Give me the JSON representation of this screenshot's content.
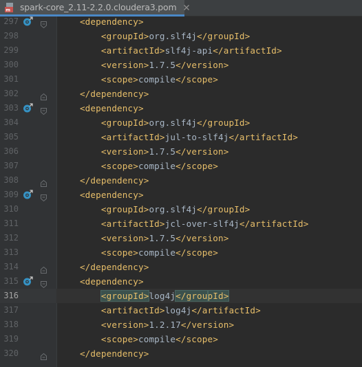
{
  "tab": {
    "title": "spark-core_2.11-2.2.0.cloudera3.pom",
    "file_icon": "maven-pom-file-icon",
    "close_icon": "close-icon"
  },
  "editor": {
    "indent_unit": "    ",
    "lines": [
      {
        "num": "297",
        "marker": true,
        "fold": "open",
        "indent": 1,
        "segments": [
          {
            "t": "tag",
            "v": "<dependency>"
          }
        ]
      },
      {
        "num": "298",
        "marker": false,
        "fold": "",
        "indent": 2,
        "segments": [
          {
            "t": "tag",
            "v": "<groupId>"
          },
          {
            "t": "txt",
            "v": "org.slf4j"
          },
          {
            "t": "tag",
            "v": "</groupId>"
          }
        ]
      },
      {
        "num": "299",
        "marker": false,
        "fold": "",
        "indent": 2,
        "segments": [
          {
            "t": "tag",
            "v": "<artifactId>"
          },
          {
            "t": "txt",
            "v": "slf4j-api"
          },
          {
            "t": "tag",
            "v": "</artifactId>"
          }
        ]
      },
      {
        "num": "300",
        "marker": false,
        "fold": "",
        "indent": 2,
        "segments": [
          {
            "t": "tag",
            "v": "<version>"
          },
          {
            "t": "txt",
            "v": "1.7.5"
          },
          {
            "t": "tag",
            "v": "</version>"
          }
        ]
      },
      {
        "num": "301",
        "marker": false,
        "fold": "",
        "indent": 2,
        "segments": [
          {
            "t": "tag",
            "v": "<scope>"
          },
          {
            "t": "txt",
            "v": "compile"
          },
          {
            "t": "tag",
            "v": "</scope>"
          }
        ]
      },
      {
        "num": "302",
        "marker": false,
        "fold": "close",
        "indent": 1,
        "segments": [
          {
            "t": "tag",
            "v": "</dependency>"
          }
        ]
      },
      {
        "num": "303",
        "marker": true,
        "fold": "open",
        "indent": 1,
        "segments": [
          {
            "t": "tag",
            "v": "<dependency>"
          }
        ]
      },
      {
        "num": "304",
        "marker": false,
        "fold": "",
        "indent": 2,
        "segments": [
          {
            "t": "tag",
            "v": "<groupId>"
          },
          {
            "t": "txt",
            "v": "org.slf4j"
          },
          {
            "t": "tag",
            "v": "</groupId>"
          }
        ]
      },
      {
        "num": "305",
        "marker": false,
        "fold": "",
        "indent": 2,
        "segments": [
          {
            "t": "tag",
            "v": "<artifactId>"
          },
          {
            "t": "txt",
            "v": "jul-to-slf4j"
          },
          {
            "t": "tag",
            "v": "</artifactId>"
          }
        ]
      },
      {
        "num": "306",
        "marker": false,
        "fold": "",
        "indent": 2,
        "segments": [
          {
            "t": "tag",
            "v": "<version>"
          },
          {
            "t": "txt",
            "v": "1.7.5"
          },
          {
            "t": "tag",
            "v": "</version>"
          }
        ]
      },
      {
        "num": "307",
        "marker": false,
        "fold": "",
        "indent": 2,
        "segments": [
          {
            "t": "tag",
            "v": "<scope>"
          },
          {
            "t": "txt",
            "v": "compile"
          },
          {
            "t": "tag",
            "v": "</scope>"
          }
        ]
      },
      {
        "num": "308",
        "marker": false,
        "fold": "close",
        "indent": 1,
        "segments": [
          {
            "t": "tag",
            "v": "</dependency>"
          }
        ]
      },
      {
        "num": "309",
        "marker": true,
        "fold": "open",
        "indent": 1,
        "segments": [
          {
            "t": "tag",
            "v": "<dependency>"
          }
        ]
      },
      {
        "num": "310",
        "marker": false,
        "fold": "",
        "indent": 2,
        "segments": [
          {
            "t": "tag",
            "v": "<groupId>"
          },
          {
            "t": "txt",
            "v": "org.slf4j"
          },
          {
            "t": "tag",
            "v": "</groupId>"
          }
        ]
      },
      {
        "num": "311",
        "marker": false,
        "fold": "",
        "indent": 2,
        "segments": [
          {
            "t": "tag",
            "v": "<artifactId>"
          },
          {
            "t": "txt",
            "v": "jcl-over-slf4j"
          },
          {
            "t": "tag",
            "v": "</artifactId>"
          }
        ]
      },
      {
        "num": "312",
        "marker": false,
        "fold": "",
        "indent": 2,
        "segments": [
          {
            "t": "tag",
            "v": "<version>"
          },
          {
            "t": "txt",
            "v": "1.7.5"
          },
          {
            "t": "tag",
            "v": "</version>"
          }
        ]
      },
      {
        "num": "313",
        "marker": false,
        "fold": "",
        "indent": 2,
        "segments": [
          {
            "t": "tag",
            "v": "<scope>"
          },
          {
            "t": "txt",
            "v": "compile"
          },
          {
            "t": "tag",
            "v": "</scope>"
          }
        ]
      },
      {
        "num": "314",
        "marker": false,
        "fold": "close",
        "indent": 1,
        "segments": [
          {
            "t": "tag",
            "v": "</dependency>"
          }
        ]
      },
      {
        "num": "315",
        "marker": true,
        "fold": "open",
        "indent": 1,
        "segments": [
          {
            "t": "tag",
            "v": "<dependency>"
          }
        ]
      },
      {
        "num": "316",
        "marker": false,
        "fold": "",
        "indent": 2,
        "current": true,
        "segments": [
          {
            "t": "tag",
            "v": "<groupId>",
            "hl": true
          },
          {
            "t": "txt",
            "v": "log4j"
          },
          {
            "t": "tag",
            "v": "</grou",
            "hl": true
          },
          {
            "t": "caret",
            "v": ""
          },
          {
            "t": "tag",
            "v": "pId>",
            "hl": true
          }
        ]
      },
      {
        "num": "317",
        "marker": false,
        "fold": "",
        "indent": 2,
        "segments": [
          {
            "t": "tag",
            "v": "<artifactId>"
          },
          {
            "t": "txt",
            "v": "log4j"
          },
          {
            "t": "tag",
            "v": "</artifactId>"
          }
        ]
      },
      {
        "num": "318",
        "marker": false,
        "fold": "",
        "indent": 2,
        "segments": [
          {
            "t": "tag",
            "v": "<version>"
          },
          {
            "t": "txt",
            "v": "1.2.17"
          },
          {
            "t": "tag",
            "v": "</version>"
          }
        ]
      },
      {
        "num": "319",
        "marker": false,
        "fold": "",
        "indent": 2,
        "segments": [
          {
            "t": "tag",
            "v": "<scope>"
          },
          {
            "t": "txt",
            "v": "compile"
          },
          {
            "t": "tag",
            "v": "</scope>"
          }
        ]
      },
      {
        "num": "320",
        "marker": false,
        "fold": "close",
        "indent": 1,
        "segments": [
          {
            "t": "tag",
            "v": "</dependency>"
          }
        ]
      }
    ]
  },
  "colors": {
    "background": "#2b2b2b",
    "gutter": "#313335",
    "tag": "#e8bf6a",
    "text": "#a9b7c6",
    "line_number": "#606366",
    "tab_underline": "#4a88c7",
    "override_marker": "#3592c4"
  }
}
